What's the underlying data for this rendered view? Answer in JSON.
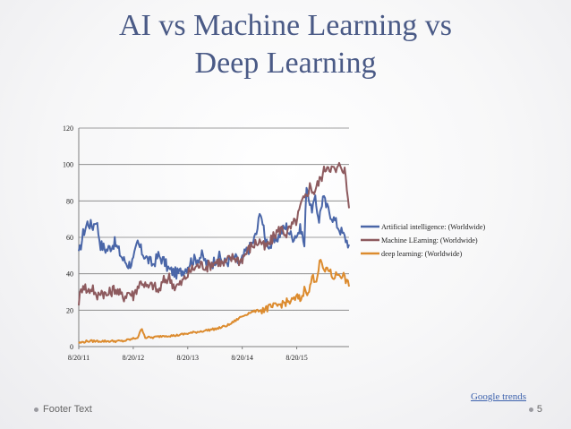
{
  "slide": {
    "title_line1": "AI vs Machine Learning vs",
    "title_line2": "Deep Learning",
    "source_link": "Google trends",
    "footer": "Footer Text",
    "page_number": "5"
  },
  "chart_data": {
    "type": "line",
    "ylim": [
      0,
      120
    ],
    "y_ticks": [
      "0",
      "20",
      "40",
      "60",
      "80",
      "100",
      "120"
    ],
    "x_ticks": [
      "8/20/11",
      "8/20/12",
      "8/20/13",
      "8/20/14",
      "8/20/15"
    ],
    "x_range_years": [
      2011.64,
      2016.6
    ],
    "grid": true,
    "legend_position": "right",
    "series": [
      {
        "name": "Artificial intelligence: (Worldwide)",
        "color": "#4a66a8",
        "points": [
          [
            2011.64,
            50
          ],
          [
            2011.72,
            62
          ],
          [
            2011.8,
            68
          ],
          [
            2011.9,
            66
          ],
          [
            2011.96,
            70
          ],
          [
            2012.04,
            56
          ],
          [
            2012.15,
            53
          ],
          [
            2012.3,
            57
          ],
          [
            2012.45,
            48
          ],
          [
            2012.55,
            45
          ],
          [
            2012.64,
            47
          ],
          [
            2012.72,
            57
          ],
          [
            2012.8,
            52
          ],
          [
            2012.9,
            48
          ],
          [
            2013.0,
            45
          ],
          [
            2013.1,
            50
          ],
          [
            2013.2,
            47
          ],
          [
            2013.3,
            42
          ],
          [
            2013.45,
            40
          ],
          [
            2013.6,
            43
          ],
          [
            2013.7,
            47
          ],
          [
            2013.8,
            48
          ],
          [
            2013.9,
            50
          ],
          [
            2014.0,
            45
          ],
          [
            2014.1,
            46
          ],
          [
            2014.2,
            50
          ],
          [
            2014.3,
            46
          ],
          [
            2014.4,
            47
          ],
          [
            2014.5,
            49
          ],
          [
            2014.6,
            45
          ],
          [
            2014.7,
            52
          ],
          [
            2014.8,
            55
          ],
          [
            2014.9,
            62
          ],
          [
            2014.98,
            75
          ],
          [
            2015.05,
            60
          ],
          [
            2015.15,
            55
          ],
          [
            2015.25,
            58
          ],
          [
            2015.35,
            63
          ],
          [
            2015.45,
            66
          ],
          [
            2015.55,
            60
          ],
          [
            2015.65,
            62
          ],
          [
            2015.72,
            65
          ],
          [
            2015.78,
            55
          ],
          [
            2015.82,
            90
          ],
          [
            2015.9,
            75
          ],
          [
            2015.98,
            80
          ],
          [
            2016.05,
            70
          ],
          [
            2016.12,
            82
          ],
          [
            2016.2,
            76
          ],
          [
            2016.28,
            72
          ],
          [
            2016.36,
            68
          ],
          [
            2016.44,
            64
          ],
          [
            2016.52,
            60
          ],
          [
            2016.6,
            56
          ]
        ]
      },
      {
        "name": "Machine LEarning: (Worldwide)",
        "color": "#8d5a5e",
        "points": [
          [
            2011.64,
            25
          ],
          [
            2011.72,
            35
          ],
          [
            2011.8,
            30
          ],
          [
            2011.9,
            33
          ],
          [
            2011.96,
            26
          ],
          [
            2012.04,
            31
          ],
          [
            2012.15,
            28
          ],
          [
            2012.3,
            32
          ],
          [
            2012.45,
            27
          ],
          [
            2012.55,
            30
          ],
          [
            2012.64,
            28
          ],
          [
            2012.72,
            33
          ],
          [
            2012.8,
            36
          ],
          [
            2012.9,
            32
          ],
          [
            2013.0,
            34
          ],
          [
            2013.1,
            30
          ],
          [
            2013.2,
            36
          ],
          [
            2013.3,
            38
          ],
          [
            2013.4,
            33
          ],
          [
            2013.5,
            34
          ],
          [
            2013.6,
            38
          ],
          [
            2013.7,
            42
          ],
          [
            2013.8,
            44
          ],
          [
            2013.9,
            45
          ],
          [
            2014.0,
            44
          ],
          [
            2014.1,
            46
          ],
          [
            2014.2,
            47
          ],
          [
            2014.3,
            45
          ],
          [
            2014.4,
            48
          ],
          [
            2014.5,
            49
          ],
          [
            2014.6,
            47
          ],
          [
            2014.7,
            51
          ],
          [
            2014.8,
            55
          ],
          [
            2014.9,
            57
          ],
          [
            2014.98,
            58
          ],
          [
            2015.05,
            54
          ],
          [
            2015.15,
            57
          ],
          [
            2015.25,
            62
          ],
          [
            2015.35,
            65
          ],
          [
            2015.45,
            62
          ],
          [
            2015.55,
            66
          ],
          [
            2015.65,
            70
          ],
          [
            2015.72,
            78
          ],
          [
            2015.8,
            82
          ],
          [
            2015.88,
            88
          ],
          [
            2015.96,
            85
          ],
          [
            2016.04,
            90
          ],
          [
            2016.12,
            95
          ],
          [
            2016.2,
            100
          ],
          [
            2016.28,
            98
          ],
          [
            2016.36,
            96
          ],
          [
            2016.44,
            100
          ],
          [
            2016.52,
            97
          ],
          [
            2016.6,
            76
          ]
        ]
      },
      {
        "name": "deep learning: (Worldwide)",
        "color": "#dc8b2e",
        "points": [
          [
            2011.64,
            2
          ],
          [
            2011.8,
            3
          ],
          [
            2012.0,
            3
          ],
          [
            2012.2,
            3
          ],
          [
            2012.45,
            3
          ],
          [
            2012.6,
            4
          ],
          [
            2012.72,
            5
          ],
          [
            2012.8,
            10
          ],
          [
            2012.86,
            5
          ],
          [
            2013.0,
            5
          ],
          [
            2013.2,
            6
          ],
          [
            2013.4,
            6
          ],
          [
            2013.6,
            7
          ],
          [
            2013.8,
            8
          ],
          [
            2014.0,
            9
          ],
          [
            2014.2,
            10
          ],
          [
            2014.4,
            12
          ],
          [
            2014.6,
            16
          ],
          [
            2014.8,
            19
          ],
          [
            2014.98,
            20
          ],
          [
            2015.1,
            21
          ],
          [
            2015.25,
            22
          ],
          [
            2015.4,
            24
          ],
          [
            2015.55,
            25
          ],
          [
            2015.65,
            27
          ],
          [
            2015.72,
            26
          ],
          [
            2015.8,
            33
          ],
          [
            2015.85,
            28
          ],
          [
            2015.92,
            38
          ],
          [
            2016.0,
            37
          ],
          [
            2016.08,
            48
          ],
          [
            2016.14,
            40
          ],
          [
            2016.2,
            44
          ],
          [
            2016.3,
            38
          ],
          [
            2016.4,
            40
          ],
          [
            2016.5,
            39
          ],
          [
            2016.6,
            33
          ]
        ]
      }
    ]
  }
}
